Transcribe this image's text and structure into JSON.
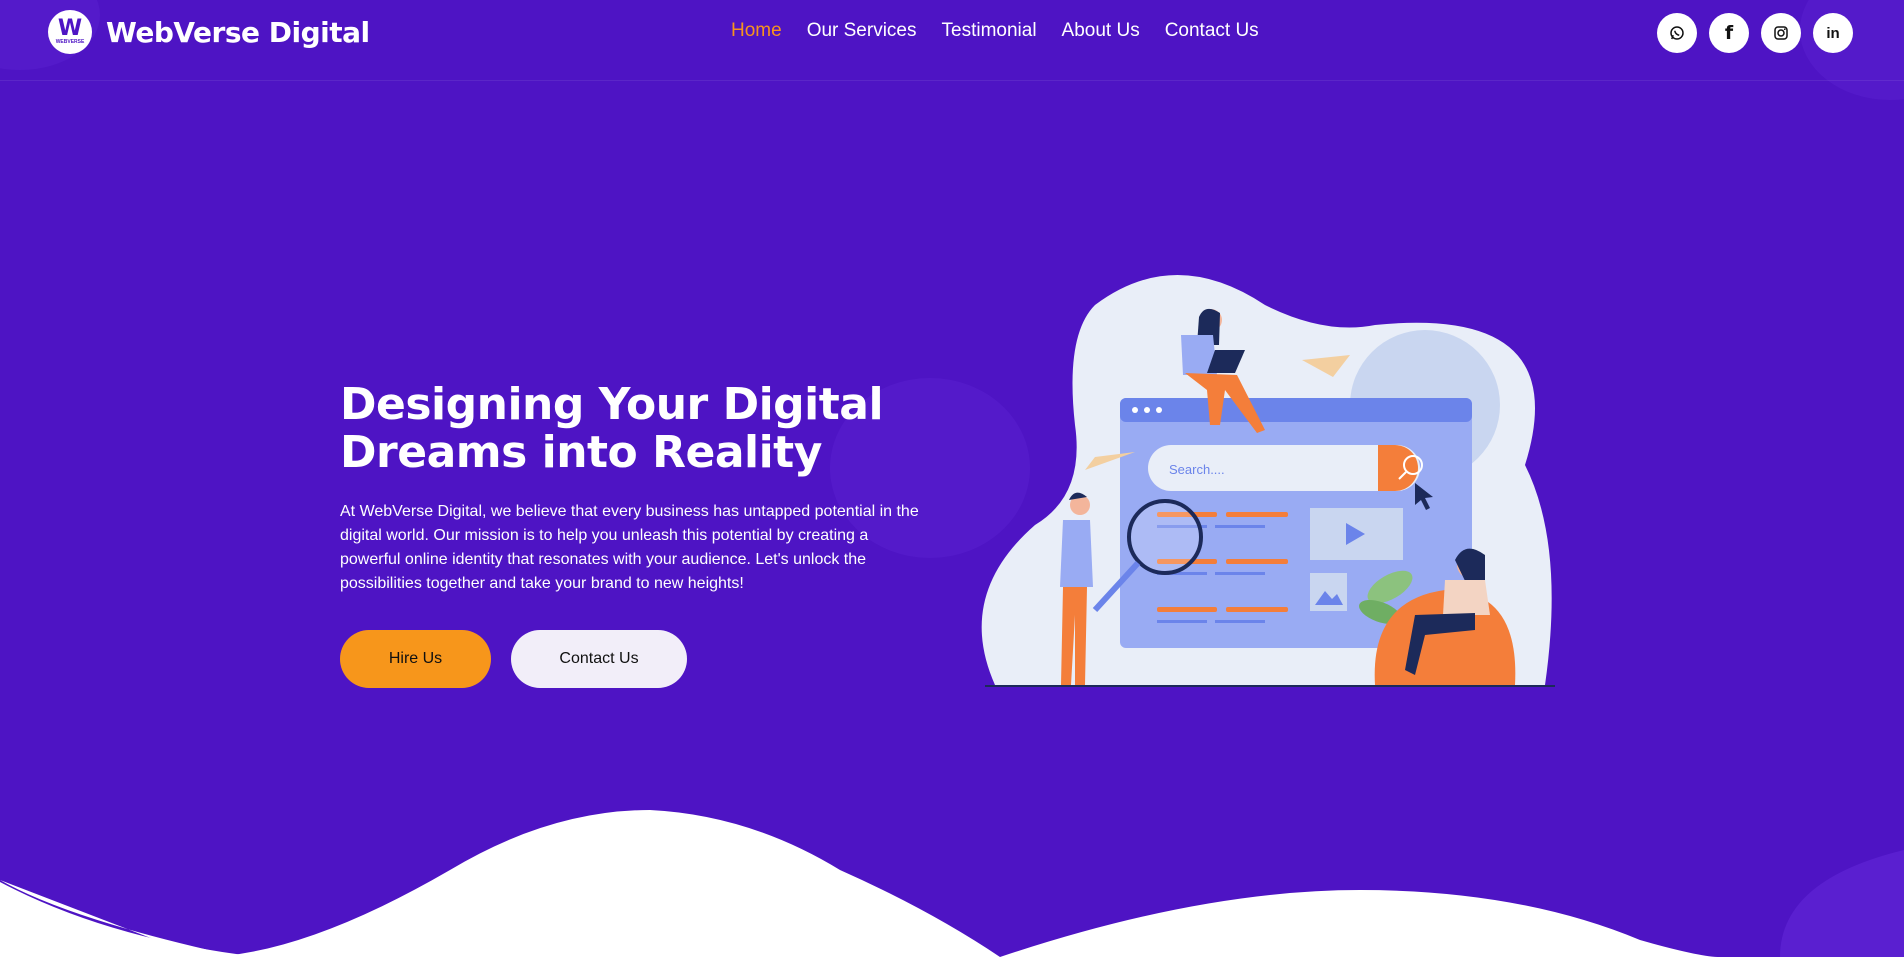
{
  "brand": {
    "name": "WebVerse Digital",
    "logo_mark": "W",
    "logo_sub": "WEBVERSE"
  },
  "nav": {
    "items": [
      {
        "label": "Home",
        "active": true
      },
      {
        "label": "Our Services",
        "active": false
      },
      {
        "label": "Testimonial",
        "active": false
      },
      {
        "label": "About Us",
        "active": false
      },
      {
        "label": "Contact Us",
        "active": false
      }
    ]
  },
  "socials": [
    {
      "icon": "whatsapp-icon"
    },
    {
      "icon": "facebook-icon",
      "glyph": "f"
    },
    {
      "icon": "instagram-icon"
    },
    {
      "icon": "linkedin-icon",
      "glyph": "in"
    }
  ],
  "hero": {
    "title": "Designing Your Digital Dreams into Reality",
    "description": "At WebVerse Digital, we believe that every business has untapped potential in the digital world. Our mission is to help you unleash this potential by creating a powerful online identity that resonates with your audience. Let's unlock the possibilities together and take your brand to new heights!",
    "hire_label": "Hire Us",
    "contact_label": "Contact Us"
  },
  "illustration": {
    "search_placeholder": "Search...."
  },
  "colors": {
    "background": "#4e14c4",
    "accent": "#f7961b",
    "active_nav": "#f7931e"
  }
}
